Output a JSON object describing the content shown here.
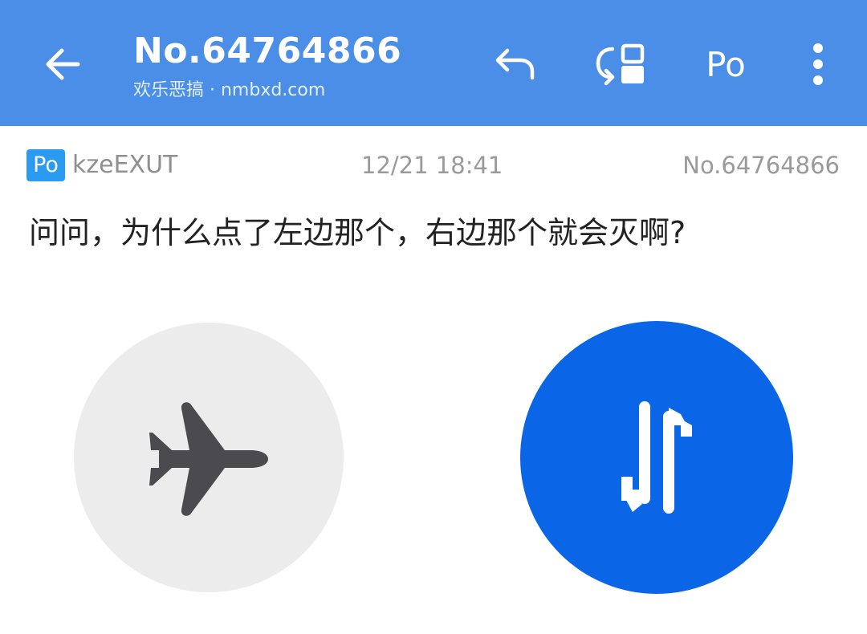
{
  "header": {
    "title": "No.64764866",
    "subtitle": "欢乐恶搞 · nmbxd.com",
    "po_label": "Po"
  },
  "post": {
    "badge": "Po",
    "user_id": "kzeEXUT",
    "time": "12/21 18:41",
    "number": "No.64764866",
    "content": "问问，为什么点了左边那个，右边那个就会灭啊?"
  },
  "image": {
    "left_toggle": {
      "icon": "airplane-icon",
      "state": "off",
      "color": "#ececec"
    },
    "right_toggle": {
      "icon": "mobile-data-icon",
      "state": "on",
      "color": "#0a66e6"
    }
  },
  "colors": {
    "header_bg": "#4a8ee7",
    "badge_bg": "#2a9bf0"
  }
}
